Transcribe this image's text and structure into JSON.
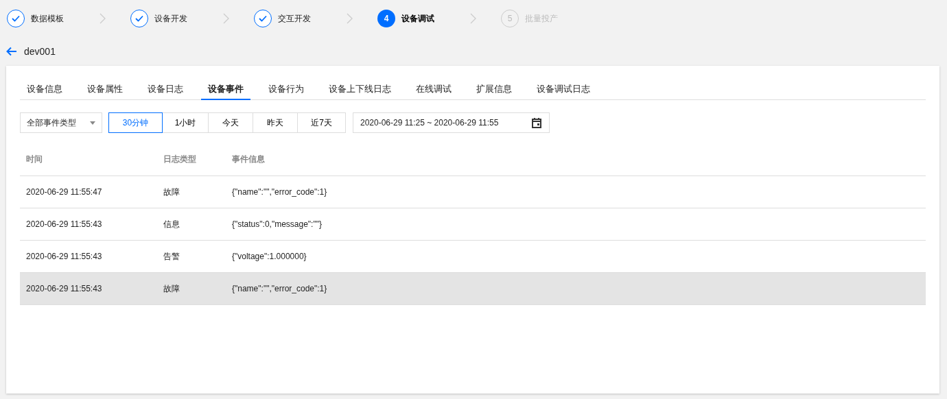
{
  "steps": [
    {
      "label": "数据模板",
      "done": true,
      "current": false
    },
    {
      "label": "设备开发",
      "done": true,
      "current": false
    },
    {
      "label": "交互开发",
      "done": true,
      "current": false
    },
    {
      "number": "4",
      "label": "设备调试",
      "done": false,
      "current": true
    },
    {
      "number": "5",
      "label": "批量投产",
      "done": false,
      "current": false
    }
  ],
  "device": {
    "name": "dev001"
  },
  "tabs": [
    {
      "label": "设备信息",
      "selected": false
    },
    {
      "label": "设备属性",
      "selected": false
    },
    {
      "label": "设备日志",
      "selected": false
    },
    {
      "label": "设备事件",
      "selected": true
    },
    {
      "label": "设备行为",
      "selected": false
    },
    {
      "label": "设备上下线日志",
      "selected": false
    },
    {
      "label": "在线调试",
      "selected": false
    },
    {
      "label": "扩展信息",
      "selected": false
    },
    {
      "label": "设备调试日志",
      "selected": false
    }
  ],
  "event_type_select": {
    "value": "全部事件类型"
  },
  "ranges": [
    {
      "label": "30分钟",
      "selected": true
    },
    {
      "label": "1小时",
      "selected": false
    },
    {
      "label": "今天",
      "selected": false
    },
    {
      "label": "昨天",
      "selected": false
    },
    {
      "label": "近7天",
      "selected": false
    }
  ],
  "date_range": {
    "value": "2020-06-29 11:25 ~ 2020-06-29 11:55"
  },
  "table": {
    "columns": [
      "时间",
      "日志类型",
      "事件信息"
    ],
    "rows": [
      {
        "cells": [
          "2020-06-29 11:55:47",
          "故障",
          "{\"name\":\"\",\"error_code\":1}"
        ],
        "selected": false
      },
      {
        "cells": [
          "2020-06-29 11:55:43",
          "信息",
          "{\"status\":0,\"message\":\"\"}"
        ],
        "selected": false
      },
      {
        "cells": [
          "2020-06-29 11:55:43",
          "告警",
          "{\"voltage\":1.000000}"
        ],
        "selected": false
      },
      {
        "cells": [
          "2020-06-29 11:55:43",
          "故障",
          "{\"name\":\"\",\"error_code\":1}"
        ],
        "selected": true
      }
    ]
  }
}
